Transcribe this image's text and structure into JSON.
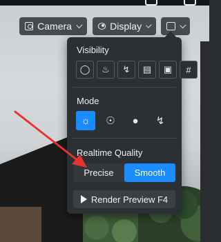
{
  "toolbar": {
    "camera_label": "Camera",
    "display_label": "Display"
  },
  "panel": {
    "visibility_label": "Visibility",
    "visibility_icons": [
      "light-bulb-icon",
      "fire-icon",
      "path-icon",
      "texture-icon",
      "video-icon",
      "grid-icon"
    ],
    "mode_label": "Mode",
    "mode_icons": [
      "sun-icon",
      "globe-icon",
      "sphere-icon",
      "run-icon"
    ],
    "quality_label": "Realtime Quality",
    "quality_options": [
      "Precise",
      "Smooth"
    ],
    "quality_selected": "Smooth",
    "render_preview_label": "Render Preview F4"
  },
  "colors": {
    "accent": "#1a8cff",
    "panel_bg": "#2c2f33",
    "annotation": "#e8322f"
  }
}
